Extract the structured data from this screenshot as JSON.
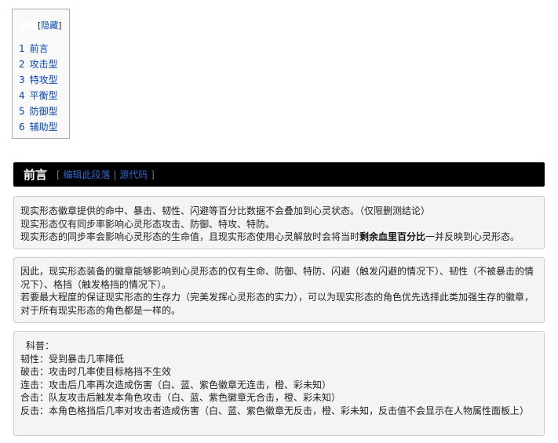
{
  "toc": {
    "title": "目录",
    "toggle_open": "[",
    "toggle_label": "隐藏",
    "toggle_close": "]",
    "items": [
      {
        "num": "1",
        "label": "前言"
      },
      {
        "num": "2",
        "label": "攻击型"
      },
      {
        "num": "3",
        "label": "特攻型"
      },
      {
        "num": "4",
        "label": "平衡型"
      },
      {
        "num": "5",
        "label": "防御型"
      },
      {
        "num": "6",
        "label": "辅助型"
      }
    ]
  },
  "section": {
    "title": "前言",
    "edit_open": "[",
    "edit_label": "编辑此段落",
    "edit_sep": "|",
    "source_label": "源代码",
    "edit_close": "]"
  },
  "box1": {
    "line1": "现实形态徽章提供的命中、暴击、韧性、闪避等百分比数据不会叠加到心灵状态。（仅限删测结论）",
    "line2": "现实形态仅有同步率影响心灵形态攻击、防御、特攻、特防。",
    "line3_pre": "现实形态的同步率会影响心灵形态的生命值，且现实形态使用心灵解放时会将当时",
    "line3_bold": "剩余血里百分比",
    "line3_post": "一并反映到心灵形态。"
  },
  "box2": {
    "line1": "因此，现实形态装备的徽章能够影响到心灵形态的仅有生命、防御、特防、闪避（触发闪避的情况下）、韧性（不被暴击的情",
    "line2": "况下）、格挡（触发格挡的情况下）。",
    "line3": "若要最大程度的保证现实形态的生存力（完美发挥心灵形态的实力），可以为现实形态的角色优先选择此类加强生存的徽章，",
    "line4": "对于所有现实形态的角色都是一样的。"
  },
  "box3": {
    "title": "科普：",
    "lines": [
      "韧性：受到暴击几率降低",
      "破击：攻击时几率使目标格挡不生效",
      "连击：攻击后几率再次造成伤害（白、蓝、紫色徽章无连击，橙、彩未知）",
      "合击：队友攻击后触发本角色攻击（白、蓝、紫色徽章无合击，橙、彩未知）",
      "反击：本角色格挡后几率对攻击者造成伤害（白、蓝、紫色徽章无反击，橙、彩未知，反击值不会显示在人物属性面板上）"
    ]
  }
}
